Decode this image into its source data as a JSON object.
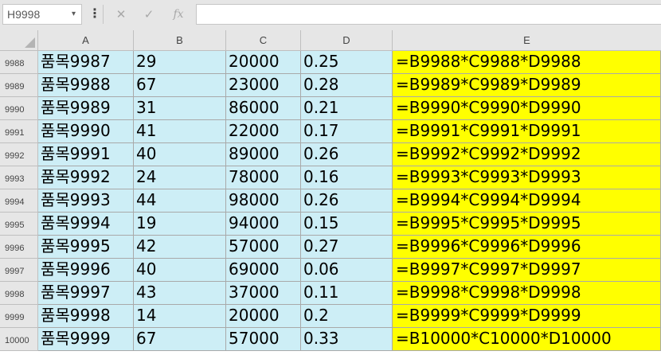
{
  "formula_bar": {
    "name_box": "H9998",
    "caret": "▾",
    "dots": "⋮",
    "cancel_glyph": "✕",
    "enter_glyph": "✓",
    "fx_label": "fx",
    "formula": ""
  },
  "columns": [
    "A",
    "B",
    "C",
    "D",
    "E"
  ],
  "rows": [
    {
      "num": "9988",
      "a": "품목9987",
      "b": "29",
      "c": "20000",
      "d": "0.25",
      "e": "=B9988*C9988*D9988"
    },
    {
      "num": "9989",
      "a": "품목9988",
      "b": "67",
      "c": "23000",
      "d": "0.28",
      "e": "=B9989*C9989*D9989"
    },
    {
      "num": "9990",
      "a": "품목9989",
      "b": "31",
      "c": "86000",
      "d": "0.21",
      "e": "=B9990*C9990*D9990"
    },
    {
      "num": "9991",
      "a": "품목9990",
      "b": "41",
      "c": "22000",
      "d": "0.17",
      "e": "=B9991*C9991*D9991"
    },
    {
      "num": "9992",
      "a": "품목9991",
      "b": "40",
      "c": "89000",
      "d": "0.26",
      "e": "=B9992*C9992*D9992"
    },
    {
      "num": "9993",
      "a": "품목9992",
      "b": "24",
      "c": "78000",
      "d": "0.16",
      "e": "=B9993*C9993*D9993"
    },
    {
      "num": "9994",
      "a": "품목9993",
      "b": "44",
      "c": "98000",
      "d": "0.26",
      "e": "=B9994*C9994*D9994"
    },
    {
      "num": "9995",
      "a": "품목9994",
      "b": "19",
      "c": "94000",
      "d": "0.15",
      "e": "=B9995*C9995*D9995"
    },
    {
      "num": "9996",
      "a": "품목9995",
      "b": "42",
      "c": "57000",
      "d": "0.27",
      "e": "=B9996*C9996*D9996"
    },
    {
      "num": "9997",
      "a": "품목9996",
      "b": "40",
      "c": "69000",
      "d": "0.06",
      "e": "=B9997*C9997*D9997"
    },
    {
      "num": "9998",
      "a": "품목9997",
      "b": "43",
      "c": "37000",
      "d": "0.11",
      "e": "=B9998*C9998*D9998"
    },
    {
      "num": "9999",
      "a": "품목9998",
      "b": "14",
      "c": "20000",
      "d": "0.2",
      "e": "=B9999*C9999*D9999"
    },
    {
      "num": "10000",
      "a": "품목9999",
      "b": "67",
      "c": "57000",
      "d": "0.33",
      "e": "=B10000*C10000*D10000"
    }
  ],
  "colors": {
    "data_fill": "#cdeef6",
    "formula_fill": "#ffff00",
    "header_fill": "#e6e6e6"
  }
}
